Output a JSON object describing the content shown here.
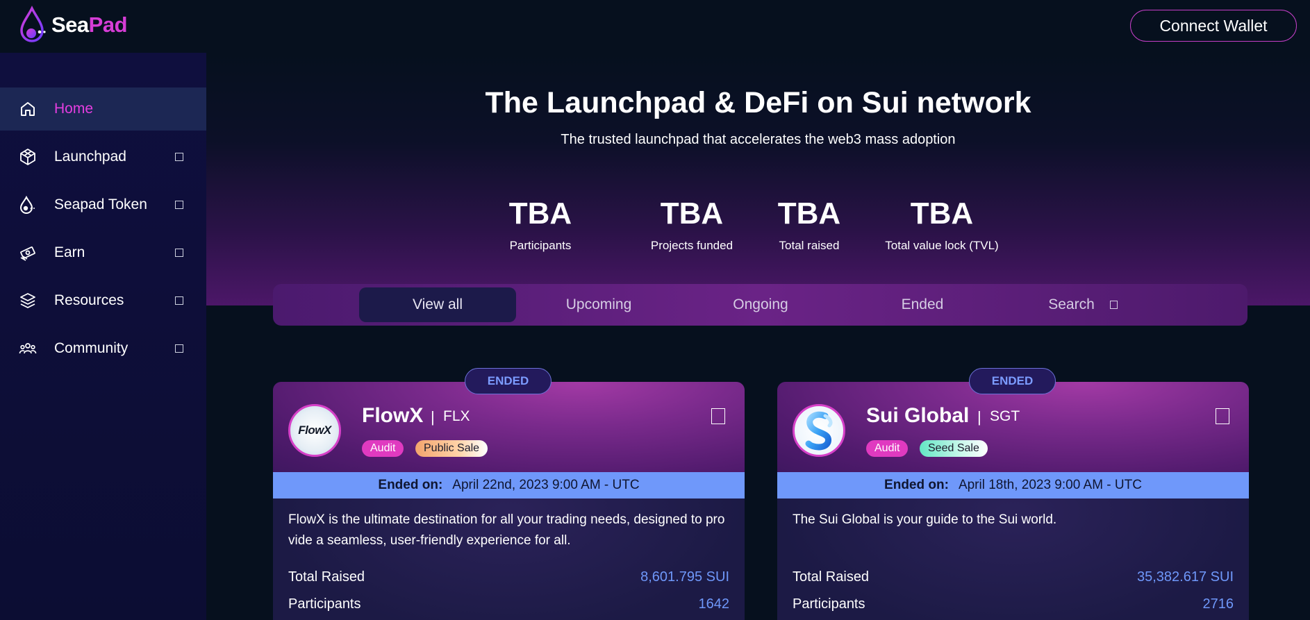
{
  "header": {
    "logo_text_a": "Sea",
    "logo_text_b": "Pad",
    "connect_label": "Connect Wallet"
  },
  "sidebar": {
    "items": [
      {
        "label": "Home",
        "icon": "home-icon",
        "active": true
      },
      {
        "label": "Launchpad",
        "icon": "launchpad-icon"
      },
      {
        "label": "Seapad Token",
        "icon": "token-icon"
      },
      {
        "label": "Earn",
        "icon": "earn-icon"
      },
      {
        "label": "Resources",
        "icon": "layers-icon"
      },
      {
        "label": "Community",
        "icon": "community-icon"
      }
    ]
  },
  "hero": {
    "title": "The Launchpad & DeFi on Sui network",
    "subtitle": "The trusted launchpad that accelerates the web3 mass adoption",
    "stats": [
      {
        "value": "TBA",
        "label": "Participants"
      },
      {
        "value": "TBA",
        "label": "Projects funded"
      },
      {
        "value": "TBA",
        "label": "Total raised"
      },
      {
        "value": "TBA",
        "label": "Total value lock (TVL)"
      }
    ]
  },
  "tabs": {
    "items": [
      "View all",
      "Upcoming",
      "Ongoing",
      "Ended",
      "Search"
    ],
    "active": "View all"
  },
  "cards": [
    {
      "status": "ENDED",
      "name": "FlowX",
      "ticker": "FLX",
      "logo_text": "FlowX",
      "badges": [
        "Audit",
        "Public Sale"
      ],
      "ended_label": "Ended on:",
      "ended_date": "April 22nd, 2023 9:00 AM - UTC",
      "description": "FlowX is the ultimate destination for all your trading needs, designed to provide a seamless, user-friendly experience for all.",
      "total_raised_label": "Total Raised",
      "total_raised": "8,601.795 SUI",
      "participants_label": "Participants",
      "participants": "1642"
    },
    {
      "status": "ENDED",
      "name": "Sui Global",
      "ticker": "SGT",
      "badges": [
        "Audit",
        "Seed Sale"
      ],
      "ended_label": "Ended on:",
      "ended_date": "April 18th, 2023 9:00 AM - UTC",
      "description": "The Sui Global is your guide to the Sui world.",
      "total_raised_label": "Total Raised",
      "total_raised": "35,382.617 SUI",
      "participants_label": "Participants",
      "participants": "2716"
    }
  ],
  "colors": {
    "accent_pink": "#e53ee0",
    "accent_blue": "#6f98fa",
    "background": "#06101e",
    "sidebar": "#0f0f3e"
  }
}
